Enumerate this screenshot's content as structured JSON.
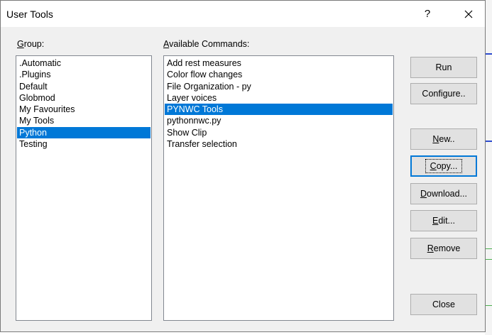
{
  "window": {
    "title": "User Tools",
    "help_label": "?"
  },
  "groups": {
    "label_mnemonic": "G",
    "label_rest": "roup:",
    "items": [
      ".Automatic",
      ".Plugins",
      "Default",
      "Globmod",
      "My Favourites",
      "My Tools",
      "Python",
      "Testing"
    ],
    "selected": "Python"
  },
  "commands": {
    "label_mnemonic": "A",
    "label_rest": "vailable Commands:",
    "items": [
      "Add rest measures",
      "Color flow changes",
      "File Organization - py",
      "Layer voices",
      "PYNWC Tools",
      "pythonnwc.py",
      "Show Clip",
      "Transfer selection"
    ],
    "selected": "PYNWC Tools"
  },
  "buttons": {
    "run": "Run",
    "configure": "Configure..",
    "new_mnemonic": "N",
    "new_rest": "ew..",
    "copy_mnemonic": "C",
    "copy_rest": "opy...",
    "download_mnemonic": "D",
    "download_rest": "ownload...",
    "edit_mnemonic": "E",
    "edit_rest": "dit...",
    "remove_mnemonic": "R",
    "remove_rest": "emove",
    "close": "Close"
  },
  "colors": {
    "selection": "#0078d7",
    "focus": "#0078d7",
    "dialog_bg": "#f0f0f0"
  }
}
